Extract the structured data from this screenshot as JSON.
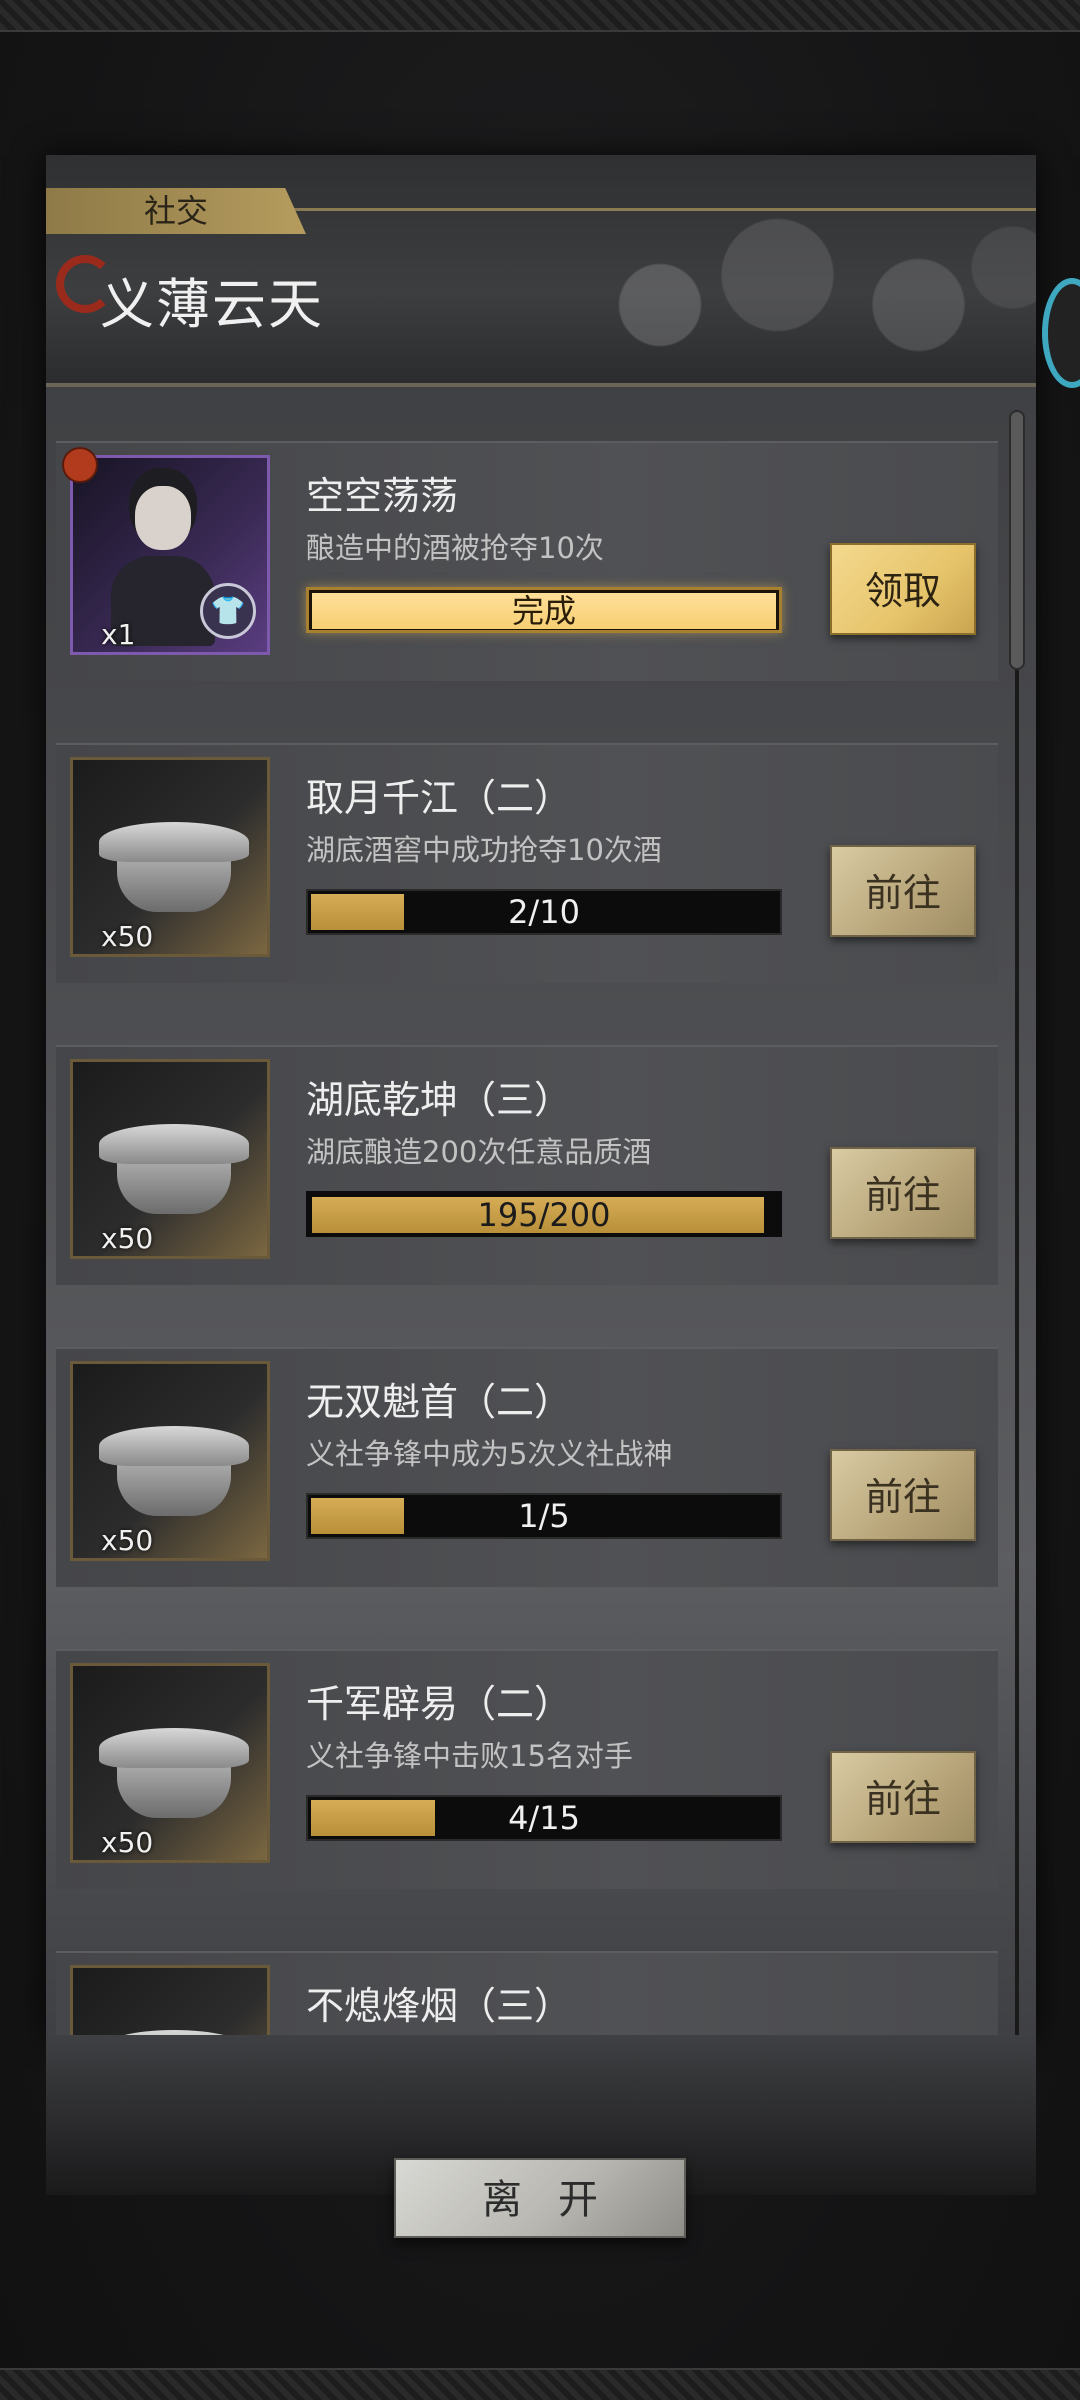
{
  "header": {
    "tab_label": "社交",
    "title": "义薄云天"
  },
  "tasks": [
    {
      "title": "空空荡荡",
      "desc": "酿造中的酒被抢夺10次",
      "reward_qty": "x1",
      "reward_icon": "character-portrait",
      "progress_text": "完成",
      "progress_fraction": 1.0,
      "completed": true,
      "action": "领取"
    },
    {
      "title": "取月千江（二）",
      "desc": "湖底酒窖中成功抢夺10次酒",
      "reward_qty": "x50",
      "reward_icon": "silver-ingot",
      "progress_text": "2/10",
      "progress_fraction": 0.2,
      "completed": false,
      "action": "前往"
    },
    {
      "title": "湖底乾坤（三）",
      "desc": "湖底酿造200次任意品质酒",
      "reward_qty": "x50",
      "reward_icon": "silver-ingot",
      "progress_text": "195/200",
      "progress_fraction": 0.975,
      "completed": false,
      "action": "前往"
    },
    {
      "title": "无双魁首（二）",
      "desc": "义社争锋中成为5次义社战神",
      "reward_qty": "x50",
      "reward_icon": "silver-ingot",
      "progress_text": "1/5",
      "progress_fraction": 0.2,
      "completed": false,
      "action": "前往"
    },
    {
      "title": "千军辟易（二）",
      "desc": "义社争锋中击败15名对手",
      "reward_qty": "x50",
      "reward_icon": "silver-ingot",
      "progress_text": "4/15",
      "progress_fraction": 0.267,
      "completed": false,
      "action": "前往"
    },
    {
      "title": "不熄烽烟（三）",
      "desc": "",
      "reward_qty": "",
      "reward_icon": "silver-ingot",
      "progress_text": "",
      "progress_fraction": 0,
      "completed": false,
      "action": ""
    }
  ],
  "footer": {
    "leave_label": "离开"
  },
  "colors": {
    "accent_gold": "#d6ad56",
    "completed_gold": "#f7cf73",
    "panel_gray": "#4a4b4e",
    "side_ring": "#3ea8c0",
    "red_dot": "#b23a1d"
  }
}
